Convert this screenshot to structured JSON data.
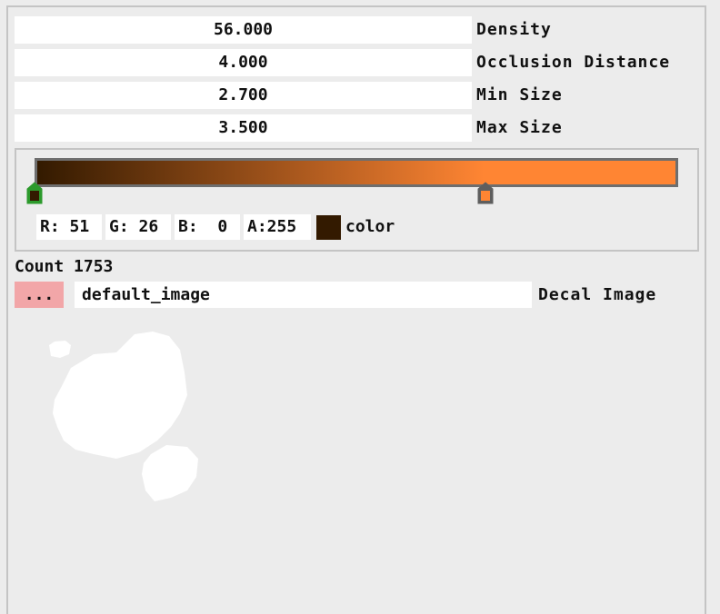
{
  "fields": [
    {
      "value": "56.000",
      "label": "Density"
    },
    {
      "value": "4.000",
      "label": "Occlusion Distance"
    },
    {
      "value": "2.700",
      "label": "Min Size"
    },
    {
      "value": "3.500",
      "label": "Max Size"
    }
  ],
  "gradient": {
    "start_color": "#331a00",
    "end_color": "#ff8533",
    "stops": [
      {
        "position": 0.0,
        "color": "#331a00",
        "selected": true
      },
      {
        "position": 0.7,
        "color": "#ff8533",
        "selected": false
      }
    ]
  },
  "color_editor": {
    "r": "R: 51",
    "g": "G: 26",
    "b": "B:  0",
    "a": "A:255",
    "swatch_color": "#331a00",
    "label": "color"
  },
  "count": "Count 1753",
  "decal": {
    "browse_label": "...",
    "path": "default_image",
    "label": "Decal Image"
  },
  "icons": {
    "preview": "decal-preview-image"
  }
}
